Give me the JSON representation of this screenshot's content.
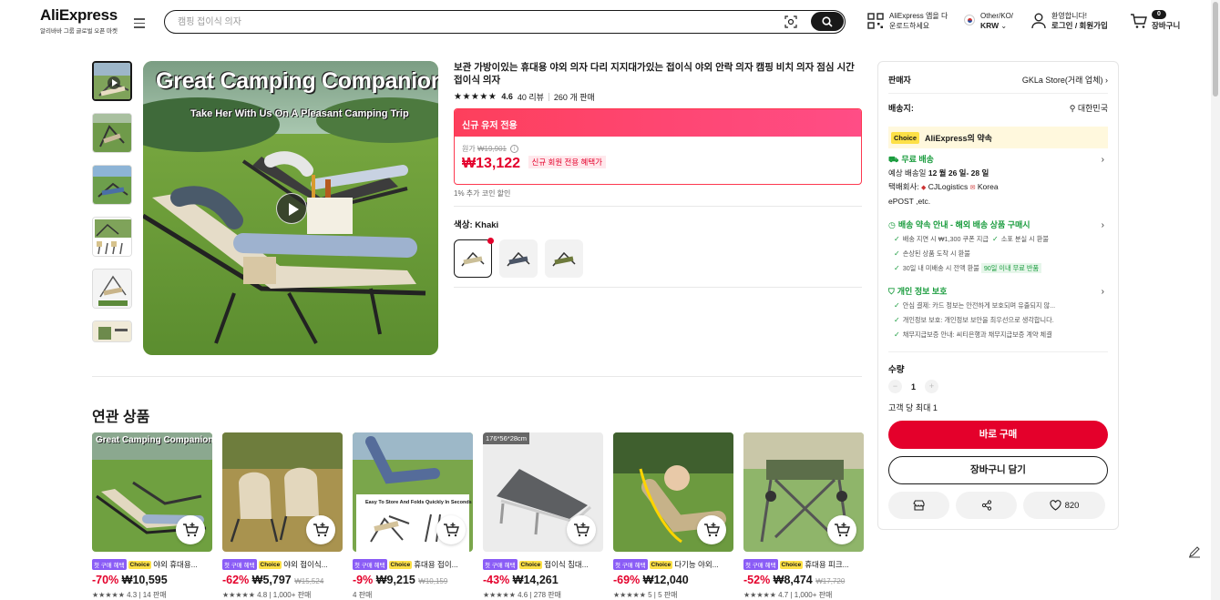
{
  "header": {
    "logo": "AliExpress",
    "logo_sub": "알리바바 그룹 글로벌 오픈 마켓",
    "search_placeholder": "캠핑 접이식 의자",
    "app_line1": "AliExpress 앱을 다",
    "app_line2": "운로드하세요",
    "locale_line1": "Other/KO/",
    "locale_line2": "KRW",
    "account_line1": "환영합니다!",
    "account_line2": "로그인 / 회원가입",
    "cart_count": "0",
    "cart_label": "장바구니"
  },
  "gallery": {
    "title": "Great Camping Companion",
    "subtitle": "Take Her With Us On A Pleasant Camping Trip"
  },
  "product": {
    "title": "보관 가방이있는 휴대용 야외 의자 다리 지지대가있는 접이식 야외 안락 의자 캠핑 비치 의자 점심 시간 접이식 의자",
    "stars": "★★★★★",
    "rating": "4.6",
    "reviews": "40 리뷰",
    "sold": "260 개 판매",
    "promo_head": "신규 유저 전용",
    "orig_label": "원가",
    "orig_price": "₩19,901",
    "price": "₩13,122",
    "price_tag": "신규 회원 전용 혜택가",
    "coin_note": "1% 추가 코인 할인",
    "color_label": "색상: Khaki"
  },
  "related": {
    "title": "연관 상품",
    "first_tag": "첫 구매 혜택",
    "choice_tag": "Choice",
    "items": [
      {
        "name": "야외 휴대용...",
        "disc": "-70%",
        "price": "₩10,595",
        "orig": "",
        "stars": "★★★★★",
        "rate": "4.3 | 14 판매"
      },
      {
        "name": "야외 접이식...",
        "disc": "-62%",
        "price": "₩5,797",
        "orig": "₩15,524",
        "stars": "★★★★★",
        "rate": "4.8 | 1,000+ 판매"
      },
      {
        "name": "휴대용 접이...",
        "disc": "-9%",
        "price": "₩9,215",
        "orig": "₩10,159",
        "stars": "",
        "rate": "4 판매"
      },
      {
        "name": "접이식 침대...",
        "disc": "-43%",
        "price": "₩14,261",
        "orig": "",
        "stars": "★★★★★",
        "rate": "4.6 | 278 판매"
      },
      {
        "name": "다기능 야외...",
        "disc": "-69%",
        "price": "₩12,040",
        "orig": "",
        "stars": "★★★★★",
        "rate": "5 | 5 판매"
      },
      {
        "name": "휴대용 피크...",
        "disc": "-52%",
        "price": "₩8,474",
        "orig": "₩17,720",
        "stars": "★★★★★",
        "rate": "4.7 | 1,000+ 판매"
      }
    ],
    "size_badge": "176*56*28cm",
    "card1_title": "Great Camping Companion",
    "card3_caption": "Easy To Store And Folds Quickly In Seconds"
  },
  "panel": {
    "seller_label": "판매자",
    "seller": "GKLa Store(거래 업체)",
    "ship_label": "배송지:",
    "ship_to": "대한민국",
    "choice": "Choice",
    "promise": "AliExpress의 약속",
    "free_ship": "무료 배송",
    "eta_prefix": "예상 배송일",
    "eta": "12 월 26 일- 28 일",
    "courier_label": "택배회사:",
    "courier1": "CJLogistics",
    "courier2": "Korea",
    "courier3": "ePOST ,etc.",
    "guarantee_head": "배송 약속 안내 - 해외 배송 상품 구매시",
    "g1": "배송 지연 시 ₩1,300 쿠폰 지급",
    "g2": "소포 분실 시 환불",
    "g3": "손상된 상품 도착 시 환불",
    "g4": "30일 내 미배송 시 전액 환불",
    "g4_tag": "90일 이내 무료 반품",
    "privacy_head": "개인 정보 보호",
    "p1": "안심 결제: 카드 정보는 안전하게 보호되며 유출되지 않...",
    "p2": "개인정보 보호: 개인정보 보안을 최우선으로 생각합니다.",
    "p3": "채무지급보증 안내: 씨티은행과 채무지급보증 계약 체결",
    "qty_label": "수량",
    "qty": "1",
    "qty_max": "고객 당 최대 1",
    "buy": "바로 구매",
    "add_cart": "장바구니 담기",
    "likes": "820"
  }
}
